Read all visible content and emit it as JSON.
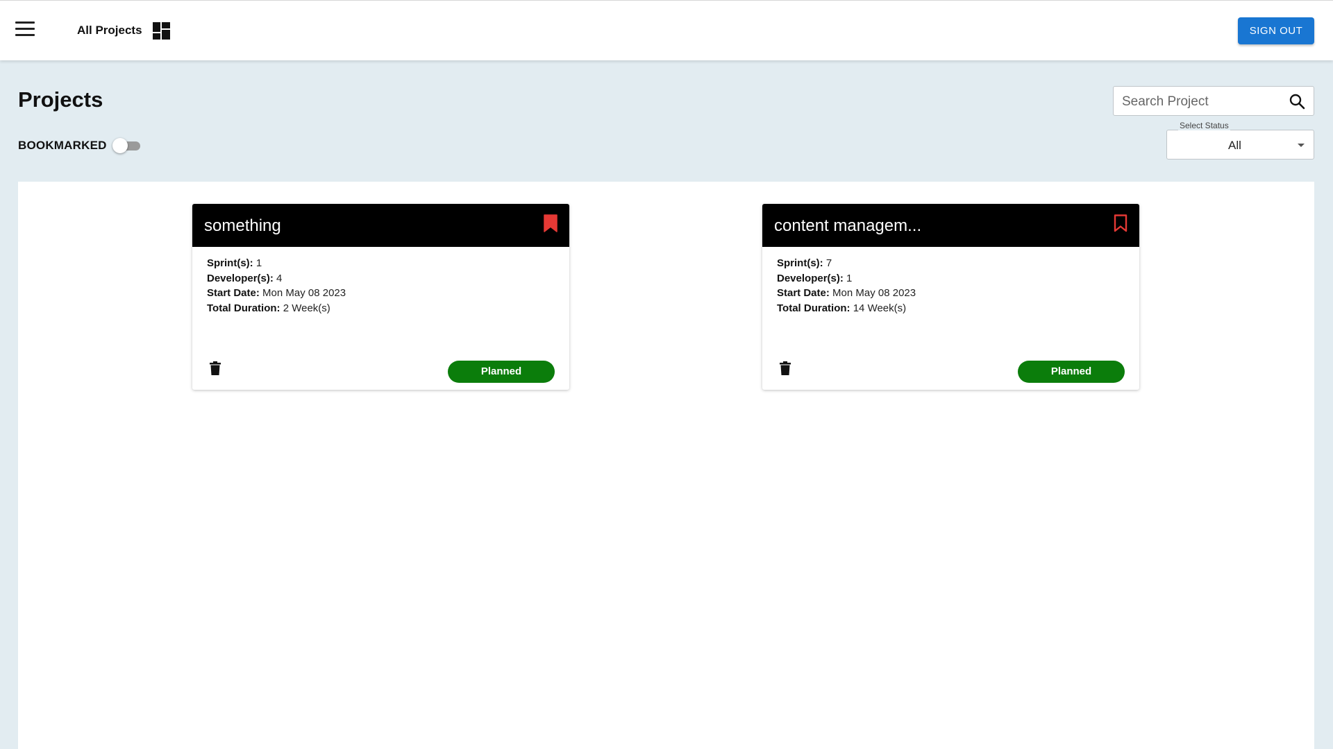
{
  "header": {
    "app_title": "All Projects",
    "sign_out_label": "SIGN OUT",
    "icons": {
      "menu": "hamburger-menu-icon",
      "dashboard": "dashboard-icon"
    }
  },
  "page": {
    "title": "Projects",
    "bookmarked_label": "BOOKMARKED",
    "bookmarked_on": false
  },
  "search": {
    "placeholder": "Search Project",
    "value": ""
  },
  "status_filter": {
    "label": "Select Status",
    "value": "All"
  },
  "colors": {
    "primary": "#1976d2",
    "background": "#e2ecf1",
    "card_header": "#000000",
    "bookmark": "#e53935",
    "status_planned": "#0b7d0b"
  },
  "projects": [
    {
      "title": "something",
      "bookmarked": true,
      "sprints_label": "Sprint(s):",
      "sprints": "1",
      "developers_label": "Developer(s):",
      "developers": "4",
      "start_label": "Start Date:",
      "start_date": "Mon May 08 2023",
      "duration_label": "Total Duration:",
      "duration": "2 Week(s)",
      "status": "Planned"
    },
    {
      "title": "content managem...",
      "bookmarked": false,
      "sprints_label": "Sprint(s):",
      "sprints": "7",
      "developers_label": "Developer(s):",
      "developers": "1",
      "start_label": "Start Date:",
      "start_date": "Mon May 08 2023",
      "duration_label": "Total Duration:",
      "duration": "14 Week(s)",
      "status": "Planned"
    }
  ]
}
